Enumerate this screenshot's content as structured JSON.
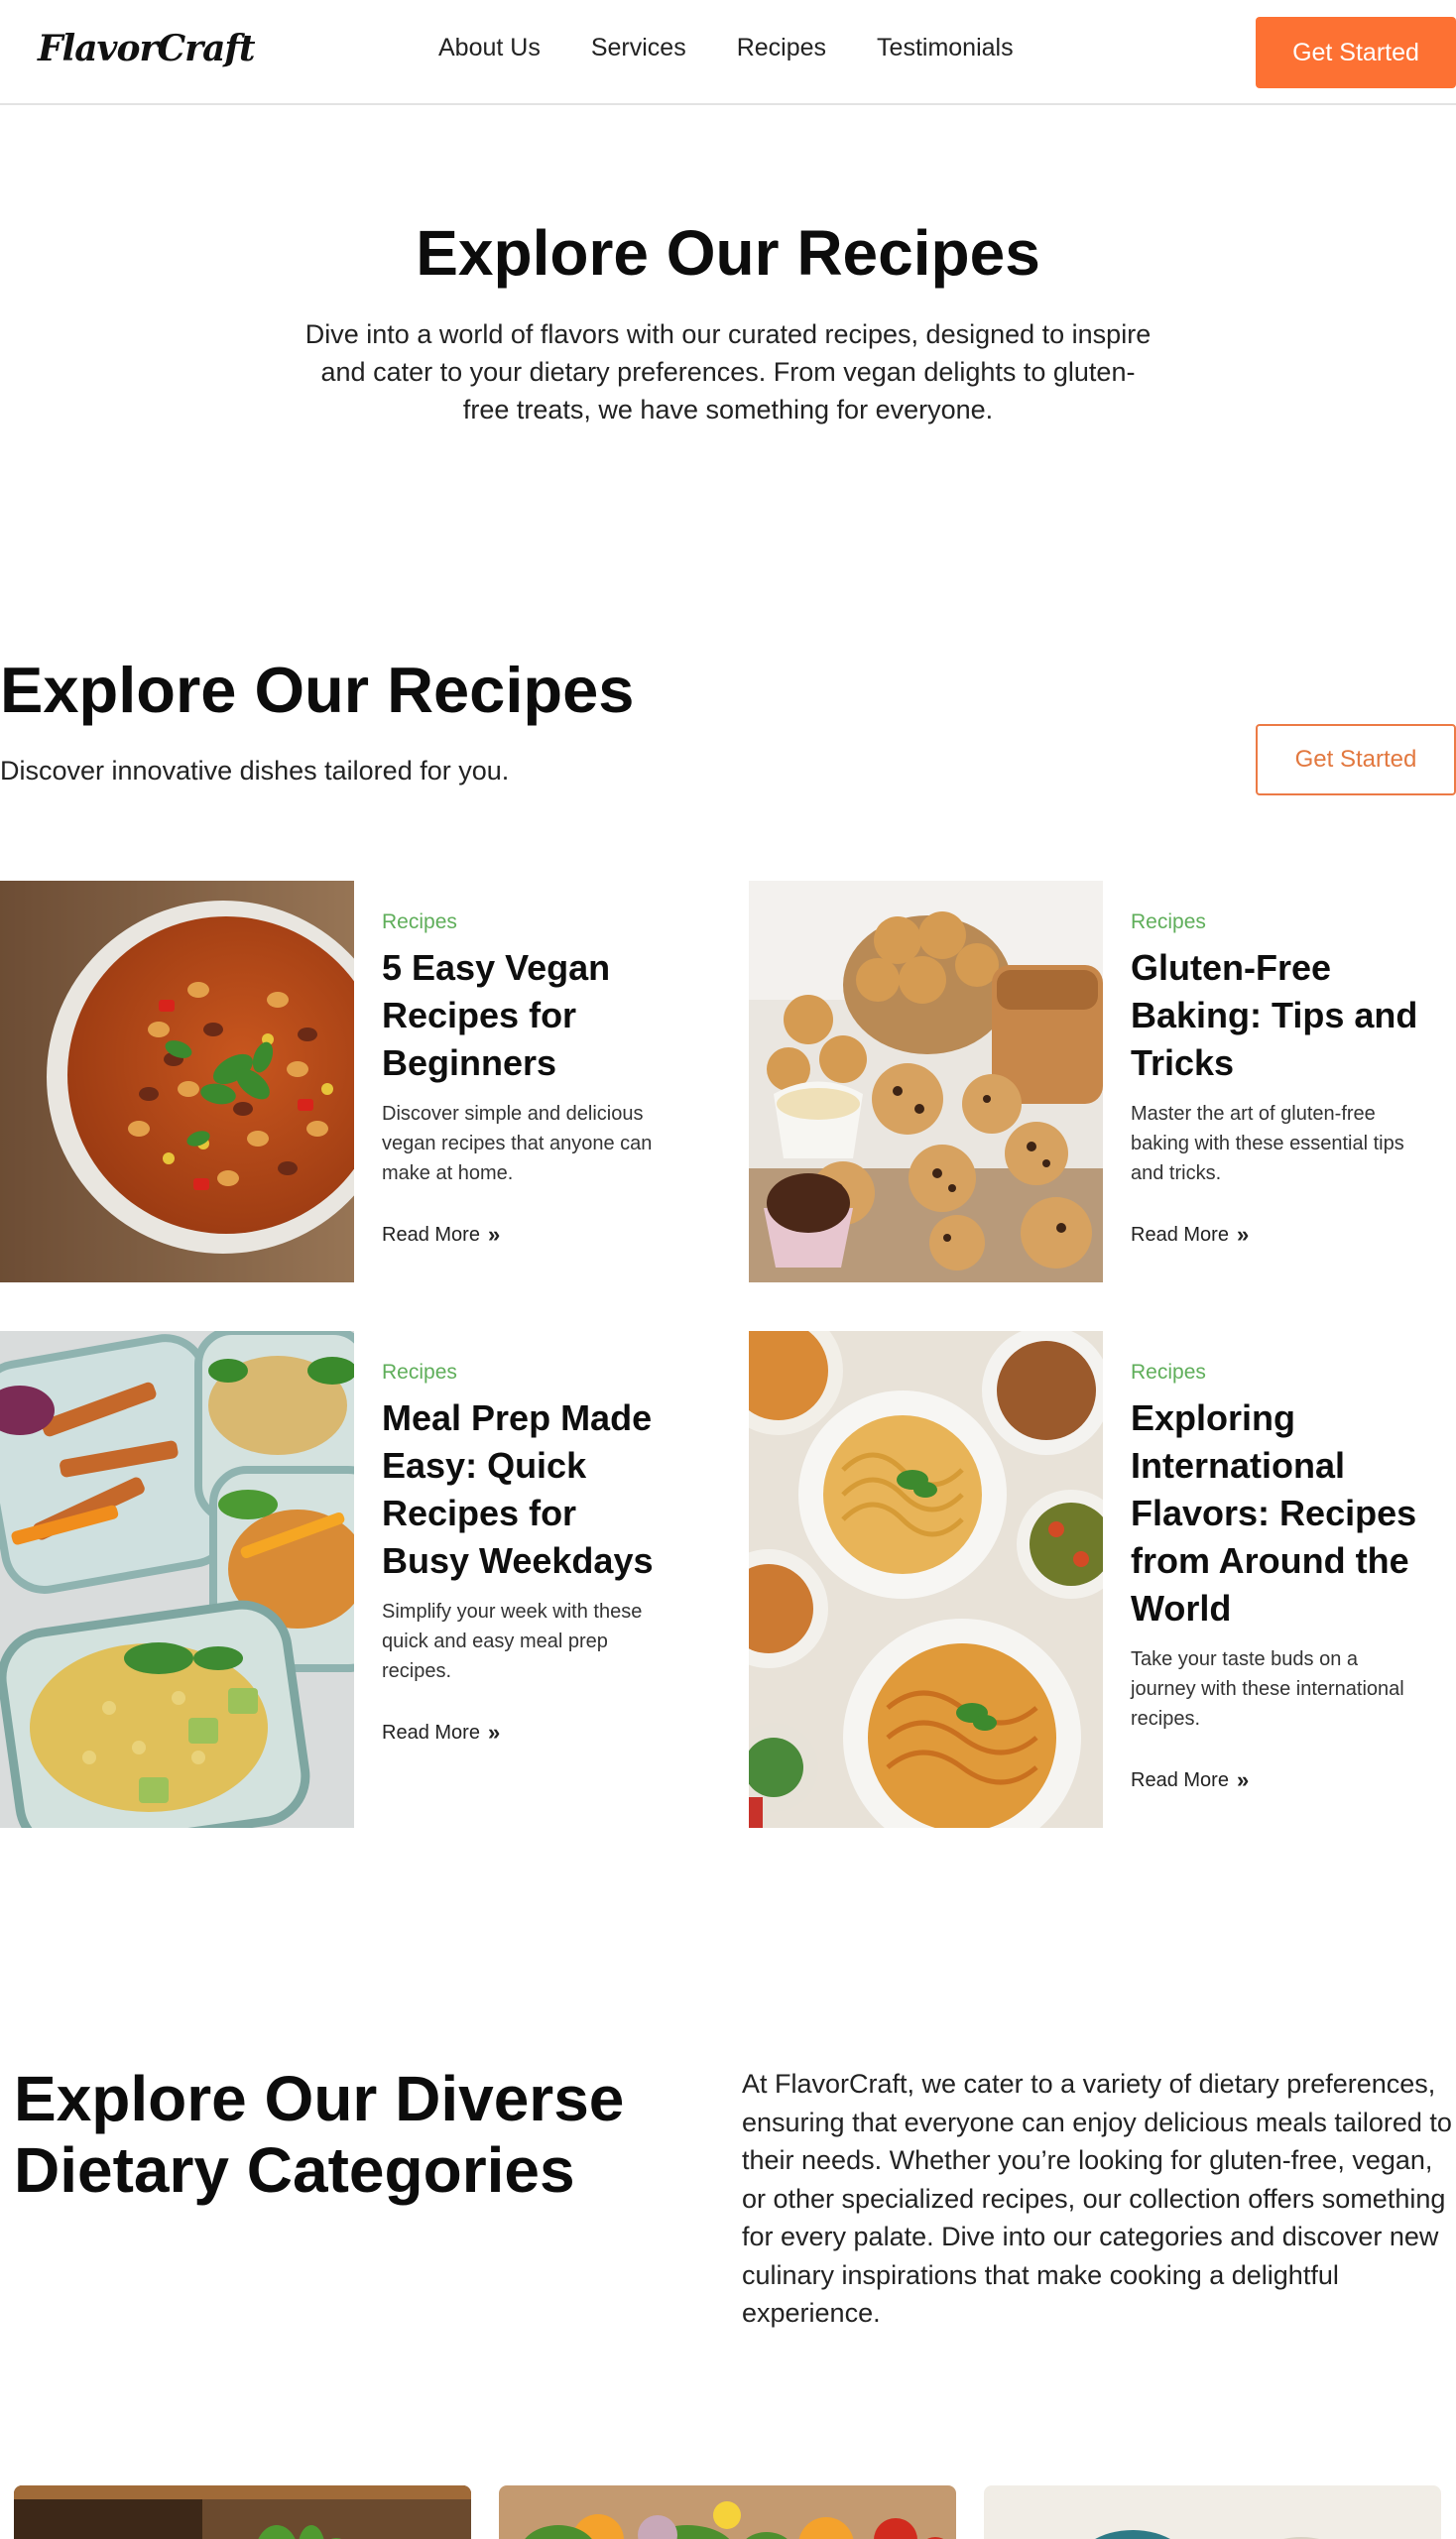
{
  "nav": {
    "logo": "FlavorCraft",
    "links": [
      "About Us",
      "Services",
      "Recipes",
      "Testimonials"
    ],
    "cta": "Get Started"
  },
  "hero": {
    "title": "Explore Our Recipes",
    "text": "Dive into a world of flavors with our curated recipes, designed to inspire and cater to your dietary preferences. From vegan delights to gluten-free treats, we have something for everyone."
  },
  "recipes_section": {
    "title": "Explore Our Recipes",
    "subtitle": "Discover innovative dishes tailored for you.",
    "cta": "Get Started",
    "cards": [
      {
        "category": "Recipes",
        "title": "5 Easy Vegan Recipes for Beginners",
        "description": "Discover simple and delicious vegan recipes that anyone can make at home.",
        "read_more": "Read More",
        "image": "bean-chili-bowl"
      },
      {
        "category": "Recipes",
        "title": "Gluten-Free Baking: Tips and Tricks",
        "description": "Master the art of gluten-free baking with these essential tips and tricks.",
        "read_more": "Read More",
        "image": "cookies-and-muffins"
      },
      {
        "category": "Recipes",
        "title": "Meal Prep Made Easy: Quick Recipes for Busy Weekdays",
        "description": "Simplify your week with these quick and easy meal prep recipes.",
        "read_more": "Read More",
        "image": "meal-prep-containers"
      },
      {
        "category": "Recipes",
        "title": "Exploring International Flavors: Recipes from Around the World",
        "description": "Take your taste buds on a journey with these international recipes.",
        "read_more": "Read More",
        "image": "pasta-dishes"
      }
    ]
  },
  "categories_section": {
    "title": "Explore Our Diverse Dietary Categories",
    "text": "At FlavorCraft, we cater to a variety of dietary preferences, ensuring that everyone can enjoy delicious meals tailored to their needs. Whether you’re looking for gluten-free, vegan, or other specialized recipes, our collection offers something for every palate. Dive into our categories and discover new culinary inspirations that make cooking a delightful experience."
  },
  "colors": {
    "accent": "#fd7133",
    "category_green": "#5fae5a",
    "text": "#111111"
  }
}
